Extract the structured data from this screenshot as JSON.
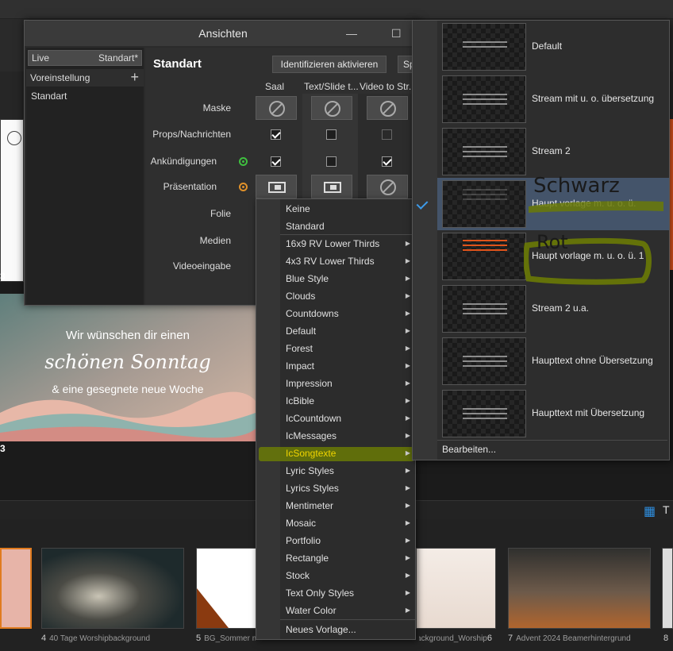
{
  "window": {
    "title": "Ansichten",
    "live_label": "Live",
    "live_value": "Standart*",
    "presets_label": "Voreinstellung",
    "preset_item": "Standart",
    "view_title": "Standart",
    "identify_button": "Identifizieren aktivieren",
    "cut_button": "Sp",
    "columns": [
      "Saal",
      "Text/Slide t...",
      "Video to Str..."
    ],
    "rows": [
      "Maske",
      "Props/Nachrichten",
      "Ankündigungen",
      "Präsentation",
      "Folie",
      "Medien",
      "Videoeingabe"
    ]
  },
  "menu": {
    "items": [
      {
        "label": "Keine",
        "arrow": ""
      },
      {
        "label": "Standard",
        "arrow": ""
      },
      {
        "label": "16x9 RV Lower Thirds",
        "arrow": "▶"
      },
      {
        "label": "4x3 RV Lower Thirds",
        "arrow": "▶"
      },
      {
        "label": "Blue Style",
        "arrow": "▶"
      },
      {
        "label": "Clouds",
        "arrow": "▶"
      },
      {
        "label": "Countdowns",
        "arrow": "▶"
      },
      {
        "label": "Default",
        "arrow": "▶"
      },
      {
        "label": "Forest",
        "arrow": "▶"
      },
      {
        "label": "Impact",
        "arrow": "▶"
      },
      {
        "label": "Impression",
        "arrow": "▶"
      },
      {
        "label": "IcBible",
        "arrow": "▶"
      },
      {
        "label": "IcCountdown",
        "arrow": "▶"
      },
      {
        "label": "IcMessages",
        "arrow": "▶"
      },
      {
        "label": "IcSongtexte",
        "arrow": "▶"
      },
      {
        "label": "Lyric Styles",
        "arrow": "▶"
      },
      {
        "label": "Lyrics Styles",
        "arrow": "▶"
      },
      {
        "label": "Mentimeter",
        "arrow": "▶"
      },
      {
        "label": "Mosaic",
        "arrow": "▶"
      },
      {
        "label": "Portfolio",
        "arrow": "▶"
      },
      {
        "label": "Rectangle",
        "arrow": "▶"
      },
      {
        "label": "Stock",
        "arrow": "▶"
      },
      {
        "label": "Text Only Styles",
        "arrow": "▶"
      },
      {
        "label": "Water Color",
        "arrow": "▶"
      },
      {
        "label": "Neues Vorlage...",
        "arrow": ""
      }
    ],
    "highlighted": "IcSongtexte"
  },
  "submenu": {
    "templates": [
      {
        "name": "Default"
      },
      {
        "name": "Stream mit u. o. übersetzung"
      },
      {
        "name": "Stream 2"
      },
      {
        "name": "Haupt vorlage m. u. o. ü."
      },
      {
        "name": "Haupt vorlage m. u. o. ü. 1"
      },
      {
        "name": "Stream 2 u.a."
      },
      {
        "name": "Haupttext ohne Übersetzung"
      },
      {
        "name": "Haupttext mit Übersetzung"
      }
    ],
    "selected": "Haupt vorlage m. u. o. ü.",
    "edit_label": "Bearbeiten...",
    "annotation_1": "Schwarz",
    "annotation_2": "Rot"
  },
  "background": {
    "slide_text_1": "Wir wünschen dir einen",
    "slide_text_2": "schönen Sonntag",
    "slide_text_3": "& eine gesegnete neue Woche",
    "thumbnails": [
      {
        "num": "4",
        "name": "40 Tage Worshipbackground"
      },
      {
        "num": "5",
        "name": "BG_Sommer mit Sprüchen"
      },
      {
        "num": "6",
        "name": "Background_Worship"
      },
      {
        "num": "7",
        "name": "Advent 2024 Beamerhintergrund"
      },
      {
        "num": "8",
        "name": ""
      }
    ]
  },
  "colors": {
    "highlight_band": "#6a7a06",
    "selected_row": "#44546a",
    "accent_blue": "#3d9be9",
    "status_green": "#3fbf3f",
    "status_orange": "#e0912a"
  }
}
